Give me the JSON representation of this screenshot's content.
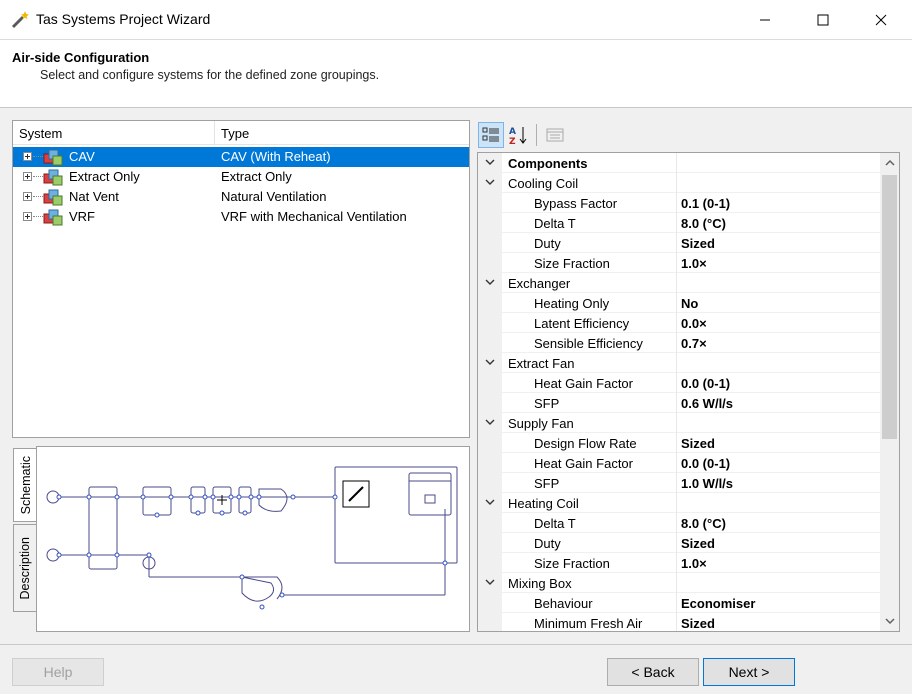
{
  "window": {
    "title": "Tas Systems Project Wizard"
  },
  "header": {
    "title": "Air-side Configuration",
    "subtitle": "Select and configure systems for the defined zone groupings."
  },
  "systems_table": {
    "columns": [
      "System",
      "Type"
    ],
    "rows": [
      {
        "name": "CAV",
        "type": "CAV (With Reheat)",
        "selected": true
      },
      {
        "name": "Extract Only",
        "type": "Extract Only",
        "selected": false
      },
      {
        "name": "Nat Vent",
        "type": "Natural Ventilation",
        "selected": false
      },
      {
        "name": "VRF",
        "type": "VRF with Mechanical Ventilation",
        "selected": false
      }
    ]
  },
  "side_tabs": {
    "schematic": "Schematic",
    "description": "Description"
  },
  "property_grid": {
    "rows": [
      {
        "kind": "cat",
        "label": "Components",
        "top": true
      },
      {
        "kind": "cat",
        "label": "Cooling Coil"
      },
      {
        "kind": "prop",
        "label": "Bypass Factor",
        "value": "0.1 (0-1)"
      },
      {
        "kind": "prop",
        "label": "Delta T",
        "value": "8.0 (°C)"
      },
      {
        "kind": "prop",
        "label": "Duty",
        "value": "Sized"
      },
      {
        "kind": "prop",
        "label": "Size Fraction",
        "value": "1.0×"
      },
      {
        "kind": "cat",
        "label": "Exchanger"
      },
      {
        "kind": "prop",
        "label": "Heating Only",
        "value": "No"
      },
      {
        "kind": "prop",
        "label": "Latent Efficiency",
        "value": "0.0×"
      },
      {
        "kind": "prop",
        "label": "Sensible Efficiency",
        "value": "0.7×"
      },
      {
        "kind": "cat",
        "label": "Extract Fan"
      },
      {
        "kind": "prop",
        "label": "Heat Gain Factor",
        "value": "0.0 (0-1)"
      },
      {
        "kind": "prop",
        "label": "SFP",
        "value": "0.6 W/l/s"
      },
      {
        "kind": "cat",
        "label": "Supply Fan"
      },
      {
        "kind": "prop",
        "label": "Design Flow Rate",
        "value": "Sized"
      },
      {
        "kind": "prop",
        "label": "Heat Gain Factor",
        "value": "0.0 (0-1)"
      },
      {
        "kind": "prop",
        "label": "SFP",
        "value": "1.0 W/l/s"
      },
      {
        "kind": "cat",
        "label": "Heating Coil"
      },
      {
        "kind": "prop",
        "label": "Delta T",
        "value": "8.0 (°C)"
      },
      {
        "kind": "prop",
        "label": "Duty",
        "value": "Sized"
      },
      {
        "kind": "prop",
        "label": "Size Fraction",
        "value": "1.0×"
      },
      {
        "kind": "cat",
        "label": "Mixing Box"
      },
      {
        "kind": "prop",
        "label": "Behaviour",
        "value": "Economiser"
      },
      {
        "kind": "prop",
        "label": "Minimum Fresh Air",
        "value": "Sized"
      }
    ]
  },
  "footer": {
    "help": "Help",
    "back": "< Back",
    "next": "Next >"
  }
}
